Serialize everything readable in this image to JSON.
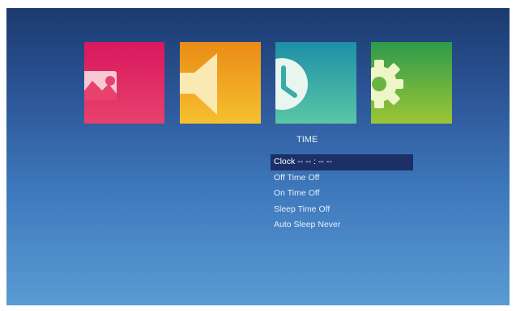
{
  "menu": {
    "title": "TIME",
    "items": [
      {
        "label": "Clock",
        "value": "-- -- : -- --",
        "selected": true
      },
      {
        "label": "Off Time",
        "value": "Off",
        "selected": false
      },
      {
        "label": "On Time",
        "value": "Off",
        "selected": false
      },
      {
        "label": "Sleep Time",
        "value": "Off",
        "selected": false
      },
      {
        "label": "Auto Sleep",
        "value": "Never",
        "selected": false
      }
    ]
  },
  "tiles": [
    {
      "icon": "photo-icon",
      "color": "#e0245f"
    },
    {
      "icon": "speaker-icon",
      "color": "#f0a52a"
    },
    {
      "icon": "clock-icon",
      "color": "#37aaa9",
      "active": true
    },
    {
      "icon": "gear-icon",
      "color": "#6ab440"
    }
  ],
  "colors": {
    "background_top": "#1c3a6e",
    "background_bottom": "#5a9bd3",
    "selection": "#1c2f66",
    "text": "#e6eefa"
  }
}
